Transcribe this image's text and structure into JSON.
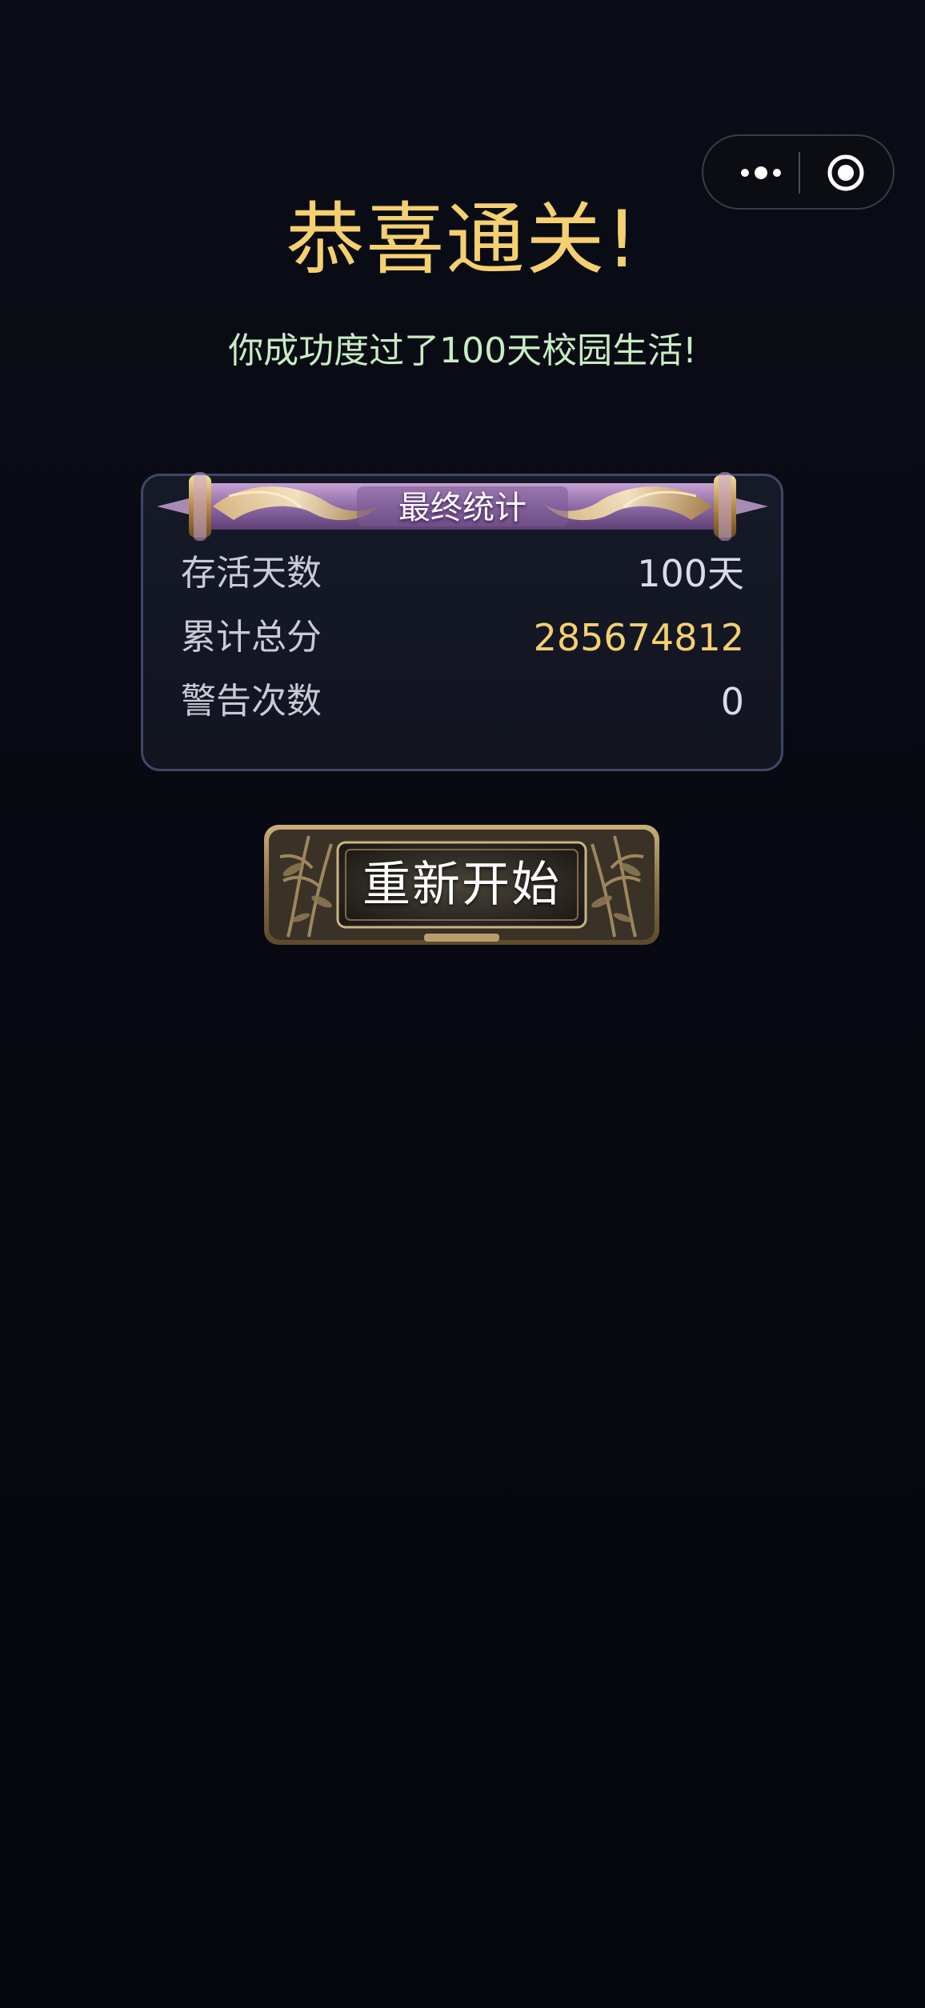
{
  "capsule": {
    "more_icon": "more-dots-icon",
    "close_icon": "target-close-icon"
  },
  "header": {
    "title": "恭喜通关!",
    "subtitle": "你成功度过了100天校园生活!"
  },
  "stats": {
    "banner_title": "最终统计",
    "rows": [
      {
        "label": "存活天数",
        "value": "100天"
      },
      {
        "label": "累计总分",
        "value": "285674812"
      },
      {
        "label": "警告次数",
        "value": "0"
      }
    ]
  },
  "actions": {
    "restart_label": "重新开始"
  },
  "colors": {
    "accent_gold": "#f4d070",
    "subtitle_green": "#c7ecc4",
    "background": "#080912",
    "card_border": "#3e4864"
  }
}
